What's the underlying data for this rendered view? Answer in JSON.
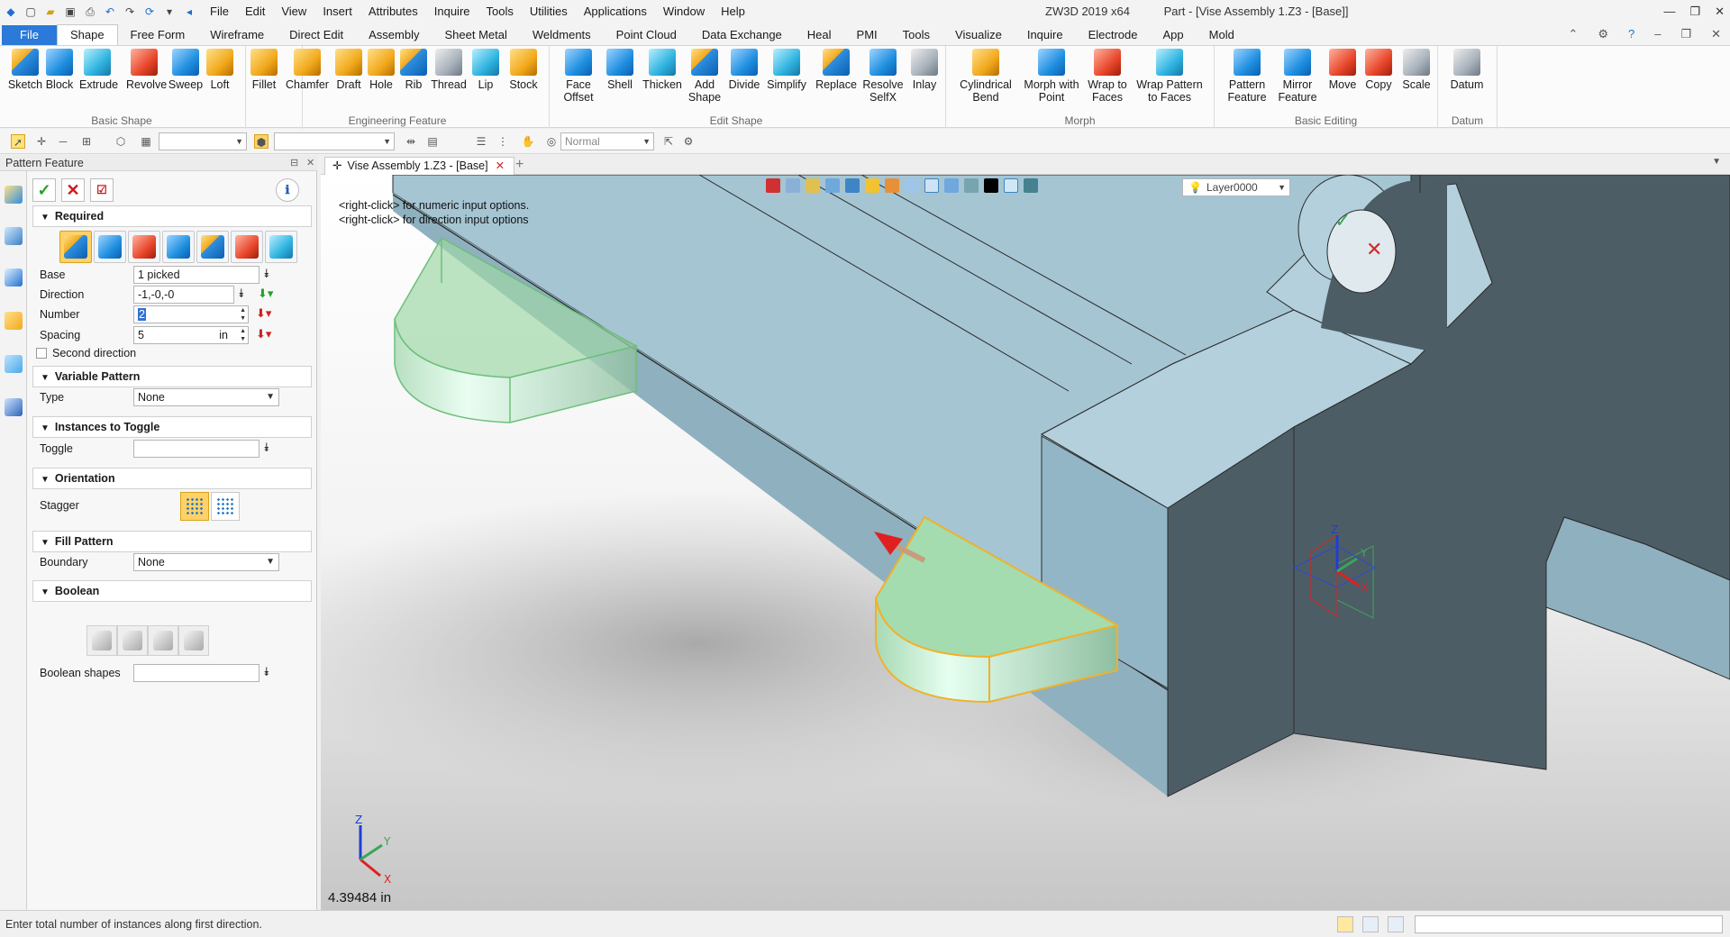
{
  "title_bar": {
    "menu": [
      "File",
      "Edit",
      "View",
      "Insert",
      "Attributes",
      "Inquire",
      "Tools",
      "Utilities",
      "Applications",
      "Window",
      "Help"
    ],
    "app_name": "ZW3D 2019  x64",
    "doc_title": "Part - [Vise Assembly 1.Z3 - [Base]]"
  },
  "ribbon_tabs": [
    "File",
    "Shape",
    "Free Form",
    "Wireframe",
    "Direct Edit",
    "Assembly",
    "Sheet Metal",
    "Weldments",
    "Point Cloud",
    "Data Exchange",
    "Heal",
    "PMI",
    "Tools",
    "Visualize",
    "Inquire",
    "Electrode",
    "App",
    "Mold"
  ],
  "active_tab": "Shape",
  "ribbon": {
    "basic_shape": {
      "label": "Basic Shape",
      "buttons": [
        "Sketch",
        "Block",
        "Extrude",
        "Revolve",
        "Sweep",
        "Loft"
      ]
    },
    "engineering_feature": {
      "label": "Engineering Feature",
      "buttons": [
        "Fillet",
        "Chamfer",
        "Draft",
        "Hole",
        "Rib",
        "Thread",
        "Lip",
        "Stock"
      ]
    },
    "edit_shape": {
      "label": "Edit Shape",
      "buttons": [
        "Face Offset",
        "Shell",
        "Thicken",
        "Add Shape",
        "Divide",
        "Simplify",
        "Replace",
        "Resolve SelfX",
        "Inlay"
      ]
    },
    "morph": {
      "label": "Morph",
      "buttons": [
        "Cylindrical Bend",
        "Morph with Point",
        "Wrap to Faces",
        "Wrap Pattern to Faces"
      ]
    },
    "basic_editing": {
      "label": "Basic Editing",
      "buttons": [
        "Pattern Feature",
        "Mirror Feature",
        "Move",
        "Copy",
        "Scale"
      ]
    },
    "datum": {
      "label": "Datum",
      "buttons": [
        "Datum"
      ]
    }
  },
  "toolbar2": {
    "render_mode": "Normal"
  },
  "panel": {
    "title": "Pattern Feature",
    "sections": {
      "required": "Required",
      "variable_pattern": "Variable Pattern",
      "instances_to_toggle": "Instances to Toggle",
      "orientation": "Orientation",
      "fill_pattern": "Fill Pattern",
      "boolean": "Boolean"
    },
    "labels": {
      "base": "Base",
      "direction": "Direction",
      "number": "Number",
      "spacing": "Spacing",
      "second_direction": "Second direction",
      "type": "Type",
      "toggle": "Toggle",
      "stagger": "Stagger",
      "boundary": "Boundary",
      "boolean_shapes": "Boolean shapes"
    },
    "values": {
      "base": "1 picked",
      "direction": "-1,-0,-0",
      "number": "2",
      "spacing": "5",
      "spacing_unit": "in",
      "type": "None",
      "toggle": "",
      "boundary": "None",
      "boolean_shapes": ""
    },
    "second_direction_checked": false
  },
  "document_tab": "Vise Assembly 1.Z3 - [Base]",
  "viewport": {
    "hint_lines": [
      "<right-click> for numeric input options.",
      "<right-click> for direction input options"
    ],
    "layer": "Layer0000",
    "measure": "4.39484 in",
    "axis_labels": {
      "x": "X",
      "y": "Y",
      "z": "Z"
    }
  },
  "status": {
    "text": "Enter total number of instances along first direction."
  }
}
